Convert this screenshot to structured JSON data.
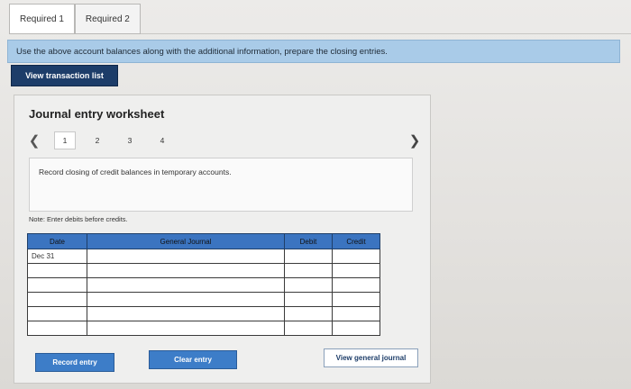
{
  "tabs": [
    {
      "label": "Required 1"
    },
    {
      "label": "Required 2"
    }
  ],
  "banner": {
    "text": "Use the above account balances along with the additional information, prepare the closing entries."
  },
  "view_transactions": {
    "label": "View transaction list"
  },
  "worksheet": {
    "title": "Journal entry worksheet",
    "steps": [
      "1",
      "2",
      "3",
      "4"
    ],
    "current_step": "1",
    "instruction": "Record closing of credit balances in temporary accounts.",
    "note": "Note: Enter debits before credits."
  },
  "table": {
    "headers": {
      "date": "Date",
      "journal": "General Journal",
      "debit": "Debit",
      "credit": "Credit"
    },
    "rows": [
      {
        "date": "Dec 31",
        "journal": "",
        "debit": "",
        "credit": ""
      },
      {
        "date": "",
        "journal": "",
        "debit": "",
        "credit": ""
      },
      {
        "date": "",
        "journal": "",
        "debit": "",
        "credit": ""
      },
      {
        "date": "",
        "journal": "",
        "debit": "",
        "credit": ""
      },
      {
        "date": "",
        "journal": "",
        "debit": "",
        "credit": ""
      },
      {
        "date": "",
        "journal": "",
        "debit": "",
        "credit": ""
      }
    ]
  },
  "buttons": {
    "record": "Record entry",
    "clear": "Clear entry",
    "view_journal": "View general journal"
  },
  "colors": {
    "banner": "#a9cbe8",
    "dark_button": "#1d3d69",
    "table_header": "#3b74c0",
    "blue_button": "#3d7dc8"
  }
}
